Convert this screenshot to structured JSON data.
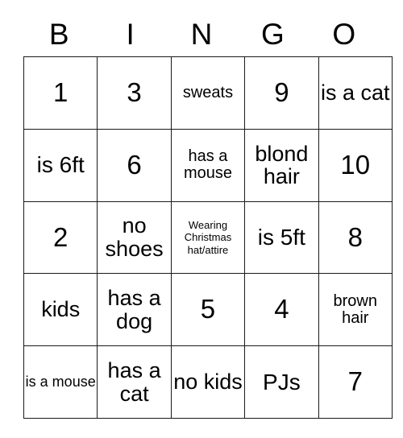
{
  "card": {
    "header": {
      "letters": [
        "B",
        "I",
        "N",
        "G",
        "O"
      ]
    },
    "rows": [
      {
        "cells": [
          {
            "text": "1",
            "size": "num"
          },
          {
            "text": "3",
            "size": "num"
          },
          {
            "text": "sweats",
            "size": "small"
          },
          {
            "text": "9",
            "size": "num"
          },
          {
            "text": "is a cat",
            "size": "med"
          }
        ]
      },
      {
        "cells": [
          {
            "text": "is 6ft",
            "size": "big"
          },
          {
            "text": "6",
            "size": "num"
          },
          {
            "text": "has a mouse",
            "size": "small"
          },
          {
            "text": "blond hair",
            "size": "med"
          },
          {
            "text": "10",
            "size": "num"
          }
        ]
      },
      {
        "cells": [
          {
            "text": "2",
            "size": "num"
          },
          {
            "text": "no shoes",
            "size": "med"
          },
          {
            "text": "Wearing Christmas hat/attire",
            "size": "tiny"
          },
          {
            "text": "is 5ft",
            "size": "big"
          },
          {
            "text": "8",
            "size": "num"
          }
        ]
      },
      {
        "cells": [
          {
            "text": "kids",
            "size": "med"
          },
          {
            "text": "has a dog",
            "size": "med"
          },
          {
            "text": "5",
            "size": "num"
          },
          {
            "text": "4",
            "size": "num"
          },
          {
            "text": "brown hair",
            "size": "small"
          }
        ]
      },
      {
        "cells": [
          {
            "text": "is a mouse",
            "size": "xsmall"
          },
          {
            "text": "has a cat",
            "size": "med"
          },
          {
            "text": "no kids",
            "size": "med"
          },
          {
            "text": "PJs",
            "size": "big"
          },
          {
            "text": "7",
            "size": "num"
          }
        ]
      }
    ],
    "colors": {
      "border": "#1a1a1a",
      "text": "#000000",
      "background": "#ffffff"
    }
  }
}
